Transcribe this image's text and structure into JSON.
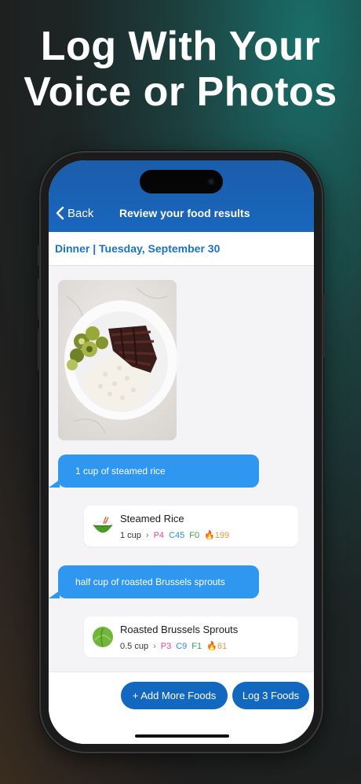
{
  "headline": {
    "line1": "Log With Your",
    "line2": "Voice or Photos"
  },
  "nav": {
    "back_label": "Back",
    "title": "Review your food results"
  },
  "meal": {
    "header": "Dinner | Tuesday, September 30"
  },
  "entries": [
    {
      "bubble": "1 cup of steamed rice",
      "food": {
        "name": "Steamed Rice",
        "icon": "rice-bowl-icon",
        "amount": "1 cup",
        "protein": "P4",
        "carbs": "C45",
        "fat": "F0",
        "calories": "199"
      }
    },
    {
      "bubble": "half cup of roasted Brussels sprouts",
      "food": {
        "name": "Roasted Brussels Sprouts",
        "icon": "brussels-sprouts-icon",
        "amount": "0.5 cup",
        "protein": "P3",
        "carbs": "C9",
        "fat": "F1",
        "calories": "61"
      }
    }
  ],
  "actions": {
    "add_more": "+ Add More Foods",
    "log": "Log 3 Foods"
  },
  "colors": {
    "brand_blue": "#1a66bd",
    "bubble_blue": "#2f97f0",
    "protein": "#d64a9a",
    "carbs": "#2b8fd8",
    "fat": "#3f9e4a",
    "calories": "#e29a3a"
  }
}
